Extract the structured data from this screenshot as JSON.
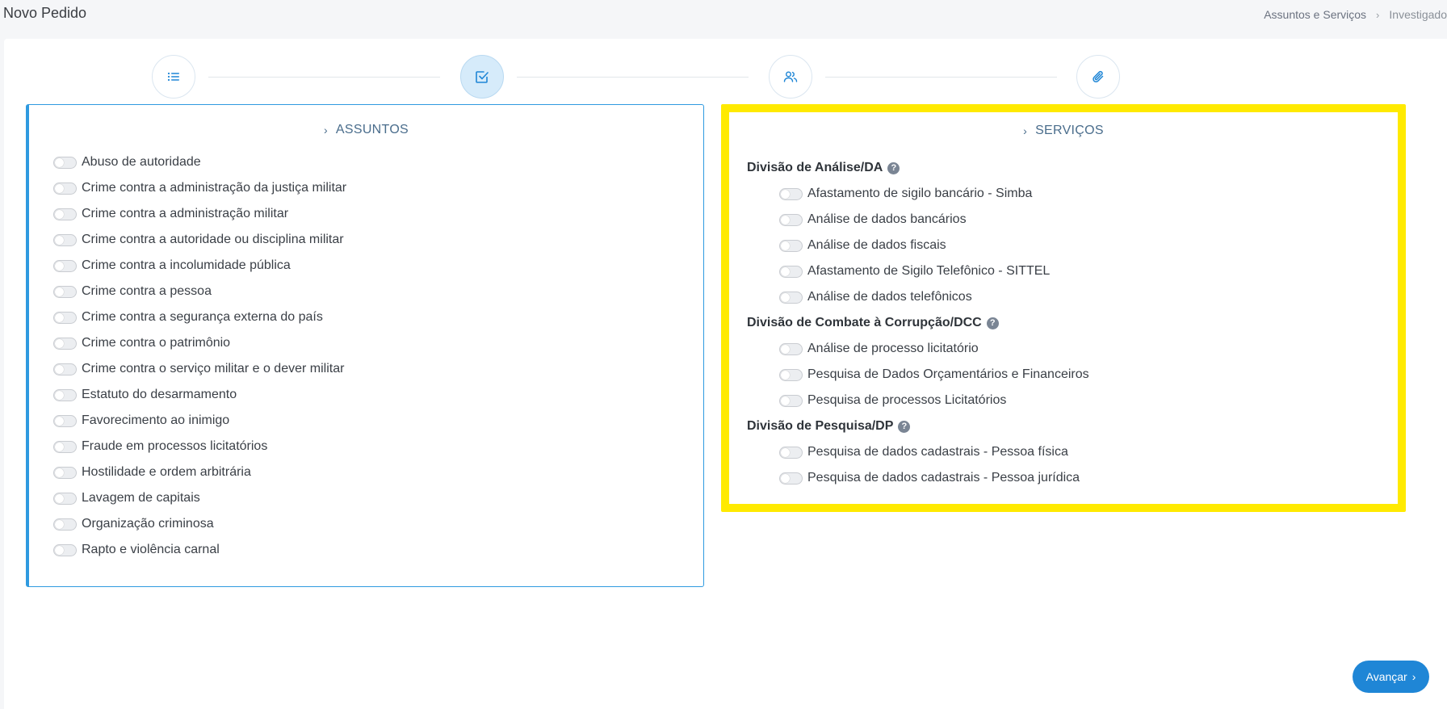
{
  "header": {
    "title": "Novo Pedido",
    "breadcrumb": [
      "Assuntos e Serviços",
      "Investigado"
    ],
    "breadcrumb_separator": "›"
  },
  "stepper": {
    "steps": [
      {
        "icon": "list-icon",
        "active": false
      },
      {
        "icon": "checkbox-icon",
        "active": true
      },
      {
        "icon": "users-icon",
        "active": false
      },
      {
        "icon": "paperclip-icon",
        "active": false
      }
    ],
    "accent_color": "#1f86d6"
  },
  "assuntos": {
    "title": "ASSUNTOS",
    "items": [
      "Abuso de autoridade",
      "Crime contra a administração da justiça militar",
      "Crime contra a administração militar",
      "Crime contra a autoridade ou disciplina militar",
      "Crime contra a incolumidade pública",
      "Crime contra a pessoa",
      "Crime contra a segurança externa do país",
      "Crime contra o patrimônio",
      "Crime contra o serviço militar e o dever militar",
      "Estatuto do desarmamento",
      "Favorecimento ao inimigo",
      "Fraude em processos licitatórios",
      "Hostilidade e ordem arbitrária",
      "Lavagem de capitais",
      "Organização criminosa",
      "Rapto e violência carnal"
    ]
  },
  "servicos": {
    "title": "SERVIÇOS",
    "help_glyph": "?",
    "highlight_color": "#ffea00",
    "groups": [
      {
        "name": "Divisão de Análise/DA",
        "items": [
          "Afastamento de sigilo bancário - Simba",
          "Análise de dados bancários",
          "Análise de dados fiscais",
          "Afastamento de Sigilo Telefônico - SITTEL",
          "Análise de dados telefônicos"
        ]
      },
      {
        "name": "Divisão de Combate à Corrupção/DCC",
        "items": [
          "Análise de processo licitatório",
          "Pesquisa de Dados Orçamentários e Financeiros",
          "Pesquisa de processos Licitatórios"
        ]
      },
      {
        "name": "Divisão de Pesquisa/DP",
        "items": [
          "Pesquisa de dados cadastrais - Pessoa física",
          "Pesquisa de dados cadastrais - Pessoa jurídica"
        ]
      }
    ]
  },
  "footer": {
    "next_label": "Avançar",
    "next_glyph": "›"
  }
}
